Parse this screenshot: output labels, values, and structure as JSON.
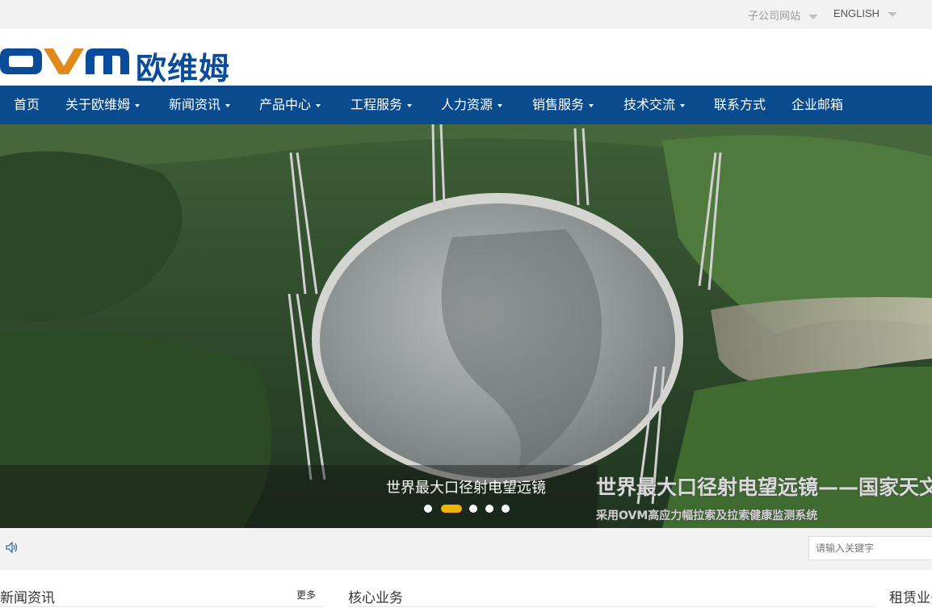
{
  "topbar": {
    "subsidiary_label": "子公司网站",
    "english_label": "ENGLISH"
  },
  "logo": {
    "text_en": "OVM",
    "text_cn": "欧维姆"
  },
  "nav": {
    "items": [
      {
        "label": "首页",
        "dropdown": false
      },
      {
        "label": "关于欧维姆",
        "dropdown": true
      },
      {
        "label": "新闻资讯",
        "dropdown": true
      },
      {
        "label": "产品中心",
        "dropdown": true
      },
      {
        "label": "工程服务",
        "dropdown": true
      },
      {
        "label": "人力资源",
        "dropdown": true
      },
      {
        "label": "销售服务",
        "dropdown": true
      },
      {
        "label": "技术交流",
        "dropdown": true
      },
      {
        "label": "联系方式",
        "dropdown": false
      },
      {
        "label": "企业邮箱",
        "dropdown": false
      }
    ]
  },
  "banner": {
    "caption": "世界最大口径射电望远镜",
    "overlay_title": "世界最大口径射电望远镜——国家天文台FAST项目",
    "overlay_subtitle": "采用OVM高应力幅拉索及拉索健康监测系统",
    "slide_count": 5,
    "active_slide": 2,
    "accent_color": "#f0b400"
  },
  "search": {
    "placeholder": "请输入关键字"
  },
  "sections": {
    "news_title": "新闻资讯",
    "news_more": "更多",
    "core_title": "核心业务",
    "lease_title": "租赁业务"
  },
  "colors": {
    "nav_bg": "#0a4b8e",
    "brand_blue": "#0a4b9a",
    "topbar_bg": "#f2f2f2"
  },
  "icons": {
    "speaker": "speaker-icon",
    "caret": "caret-down-icon"
  }
}
